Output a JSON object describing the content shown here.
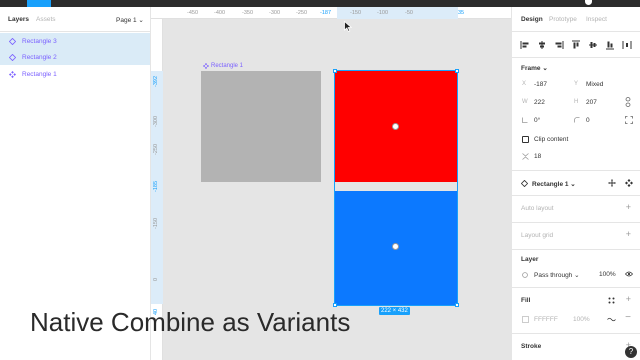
{
  "left_panel": {
    "tabs": [
      "Layers",
      "Assets"
    ],
    "page_selector": "Page 1 ⌄",
    "layers": [
      {
        "label": "Rectangle 3",
        "icon": "variant-diamond-icon",
        "selected": true
      },
      {
        "label": "Rectangle 2",
        "icon": "variant-diamond-icon",
        "selected": true
      },
      {
        "label": "Rectangle 1",
        "icon": "component-set-icon",
        "selected": false
      }
    ]
  },
  "rulers": {
    "top_ticks": [
      "-450",
      "-400",
      "-350",
      "-300",
      "-250",
      "-187",
      "-150",
      "-100",
      "-50",
      "35"
    ],
    "left_ticks": [
      "-392",
      "-300",
      "-250",
      "-185",
      "-150",
      "0",
      "40"
    ]
  },
  "canvas": {
    "frame_label": "Rectangle 1",
    "size_badge": "222 × 432",
    "colors": {
      "red": "#ff0000",
      "blue": "#0c79ff",
      "gray": "#b3b3b3",
      "selection": "#18a0fb"
    }
  },
  "caption": "Native Combine as Variants",
  "right_panel": {
    "tabs": [
      "Design",
      "Prototype",
      "Inspect"
    ],
    "frame": {
      "title": "Frame ⌄",
      "x_label": "X",
      "x_value": "-187",
      "y_label": "Y",
      "y_value": "Mixed",
      "w_label": "W",
      "w_value": "222",
      "h_label": "H",
      "h_value": "207",
      "rotation": "0°",
      "radius": "0",
      "clip_content": "Clip content",
      "spacing": "18"
    },
    "component": {
      "name": "Rectangle 1 ⌄"
    },
    "auto_layout": "Auto layout",
    "layout_grid": "Layout grid",
    "layer": {
      "title": "Layer",
      "blend": "Pass through ⌄",
      "opacity": "100%"
    },
    "fill": {
      "title": "Fill",
      "hex": "FFFFFF",
      "opacity": "100%"
    },
    "stroke": {
      "title": "Stroke"
    }
  }
}
